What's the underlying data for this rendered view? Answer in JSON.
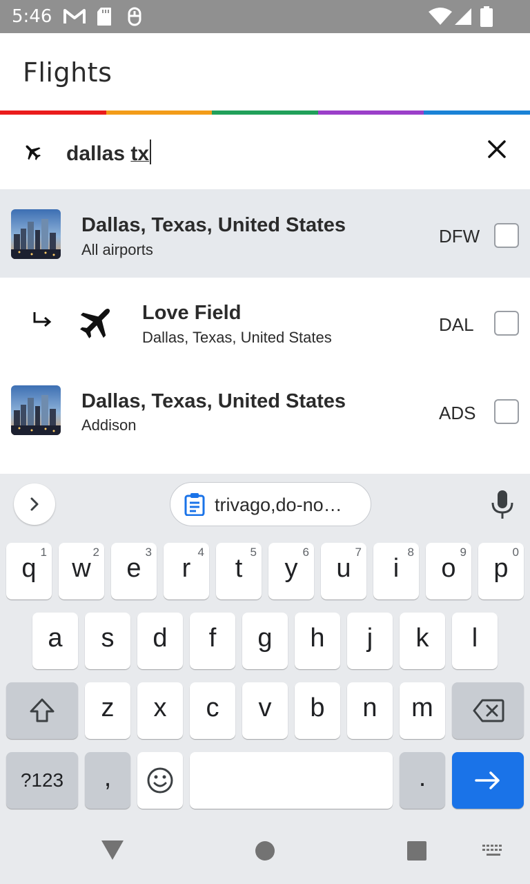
{
  "status_bar": {
    "time": "5:46",
    "icons": [
      "gmail-icon",
      "sd-card-icon",
      "accessibility-icon",
      "wifi-icon",
      "cell-signal-icon",
      "battery-icon"
    ]
  },
  "header": {
    "title": "Flights",
    "rainbow_colors": [
      "#ea1c1c",
      "#f39c19",
      "#21a05a",
      "#9b3fc9",
      "#1b82d6"
    ]
  },
  "search": {
    "value_plain": "dallas ",
    "value_underlined": "tx",
    "icon": "airplane-icon",
    "clear_icon": "close-icon"
  },
  "results": [
    {
      "title": "Dallas, Texas, United States",
      "subtitle": "All airports",
      "code": "DFW",
      "type": "city",
      "icon": "city-thumbnail",
      "checked": false
    },
    {
      "title": "Love Field",
      "subtitle": "Dallas, Texas, United States",
      "code": "DAL",
      "type": "airport",
      "icon": "airplane-icon",
      "checked": false
    },
    {
      "title": "Dallas, Texas, United States",
      "subtitle": "Addison",
      "code": "ADS",
      "type": "city",
      "icon": "city-thumbnail",
      "checked": false
    }
  ],
  "keyboard": {
    "clipboard_chip": "trivago,do-no…",
    "row1": [
      {
        "k": "q",
        "h": "1"
      },
      {
        "k": "w",
        "h": "2"
      },
      {
        "k": "e",
        "h": "3"
      },
      {
        "k": "r",
        "h": "4"
      },
      {
        "k": "t",
        "h": "5"
      },
      {
        "k": "y",
        "h": "6"
      },
      {
        "k": "u",
        "h": "7"
      },
      {
        "k": "i",
        "h": "8"
      },
      {
        "k": "o",
        "h": "9"
      },
      {
        "k": "p",
        "h": "0"
      }
    ],
    "row2": [
      "a",
      "s",
      "d",
      "f",
      "g",
      "h",
      "j",
      "k",
      "l"
    ],
    "row3": [
      "z",
      "x",
      "c",
      "v",
      "b",
      "n",
      "m"
    ],
    "symbols_label": "?123",
    "comma": ",",
    "period": ".",
    "accent_color": "#1a73e8"
  },
  "nav_bar": {
    "icons": [
      "back-icon",
      "home-icon",
      "recents-icon",
      "keyboard-switch-icon"
    ]
  }
}
